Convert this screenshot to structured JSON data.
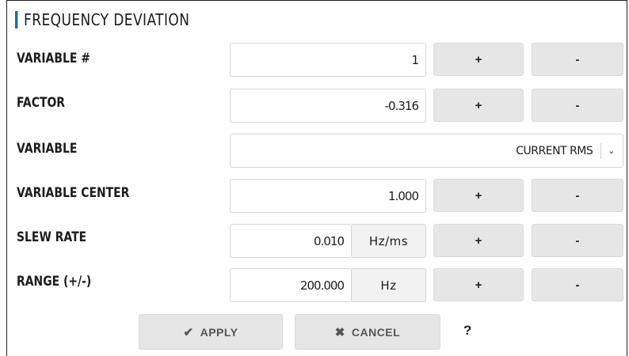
{
  "section": {
    "title": "FREQUENCY DEVIATION"
  },
  "rows": [
    {
      "label": "VARIABLE #",
      "value": "1",
      "plus": "+",
      "minus": "-"
    },
    {
      "label": "FACTOR",
      "value": "-0.316",
      "plus": "+",
      "minus": "-"
    },
    {
      "label": "VARIABLE",
      "selected": "CURRENT RMS"
    },
    {
      "label": "VARIABLE CENTER",
      "value": "1.000",
      "plus": "+",
      "minus": "-"
    },
    {
      "label": "SLEW RATE",
      "value": "0.010",
      "unit": "Hz/ms",
      "plus": "+",
      "minus": "-"
    },
    {
      "label": "RANGE (+/-)",
      "value": "200.000",
      "unit": "Hz",
      "plus": "+",
      "minus": "-"
    }
  ],
  "actions": {
    "apply": "APPLY",
    "cancel": "CANCEL",
    "help": "?"
  },
  "colors": {
    "accent": "#1a6ea3",
    "button_bg": "#e6e6e6"
  },
  "icons": {
    "apply": "check-icon",
    "cancel": "x-icon",
    "select": "chevron-down-icon"
  }
}
